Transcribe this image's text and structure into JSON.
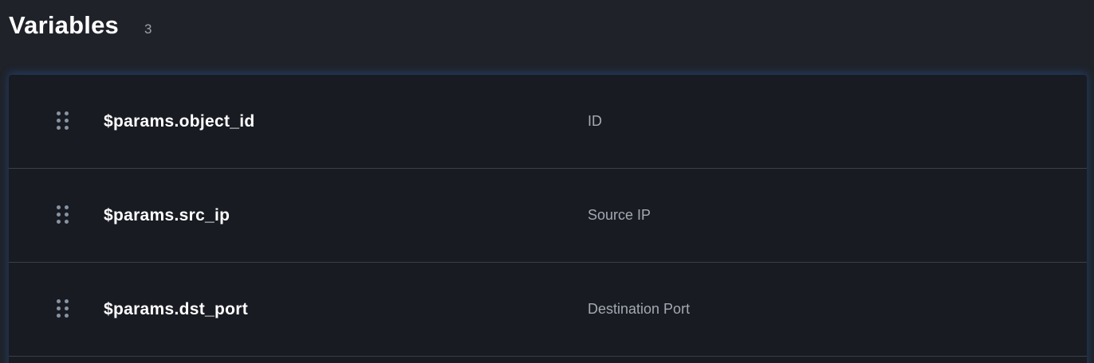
{
  "header": {
    "title": "Variables",
    "count": "3"
  },
  "variables": [
    {
      "name": "$params.object_id",
      "label": "ID"
    },
    {
      "name": "$params.src_ip",
      "label": "Source IP"
    },
    {
      "name": "$params.dst_port",
      "label": "Destination Port"
    }
  ],
  "colors": {
    "background": "#1f2229",
    "panel": "#181b22",
    "divider": "#3b3f46",
    "accent_glow": "#286ec8"
  },
  "icons": {
    "drag_handle": "drag-handle-icon"
  }
}
